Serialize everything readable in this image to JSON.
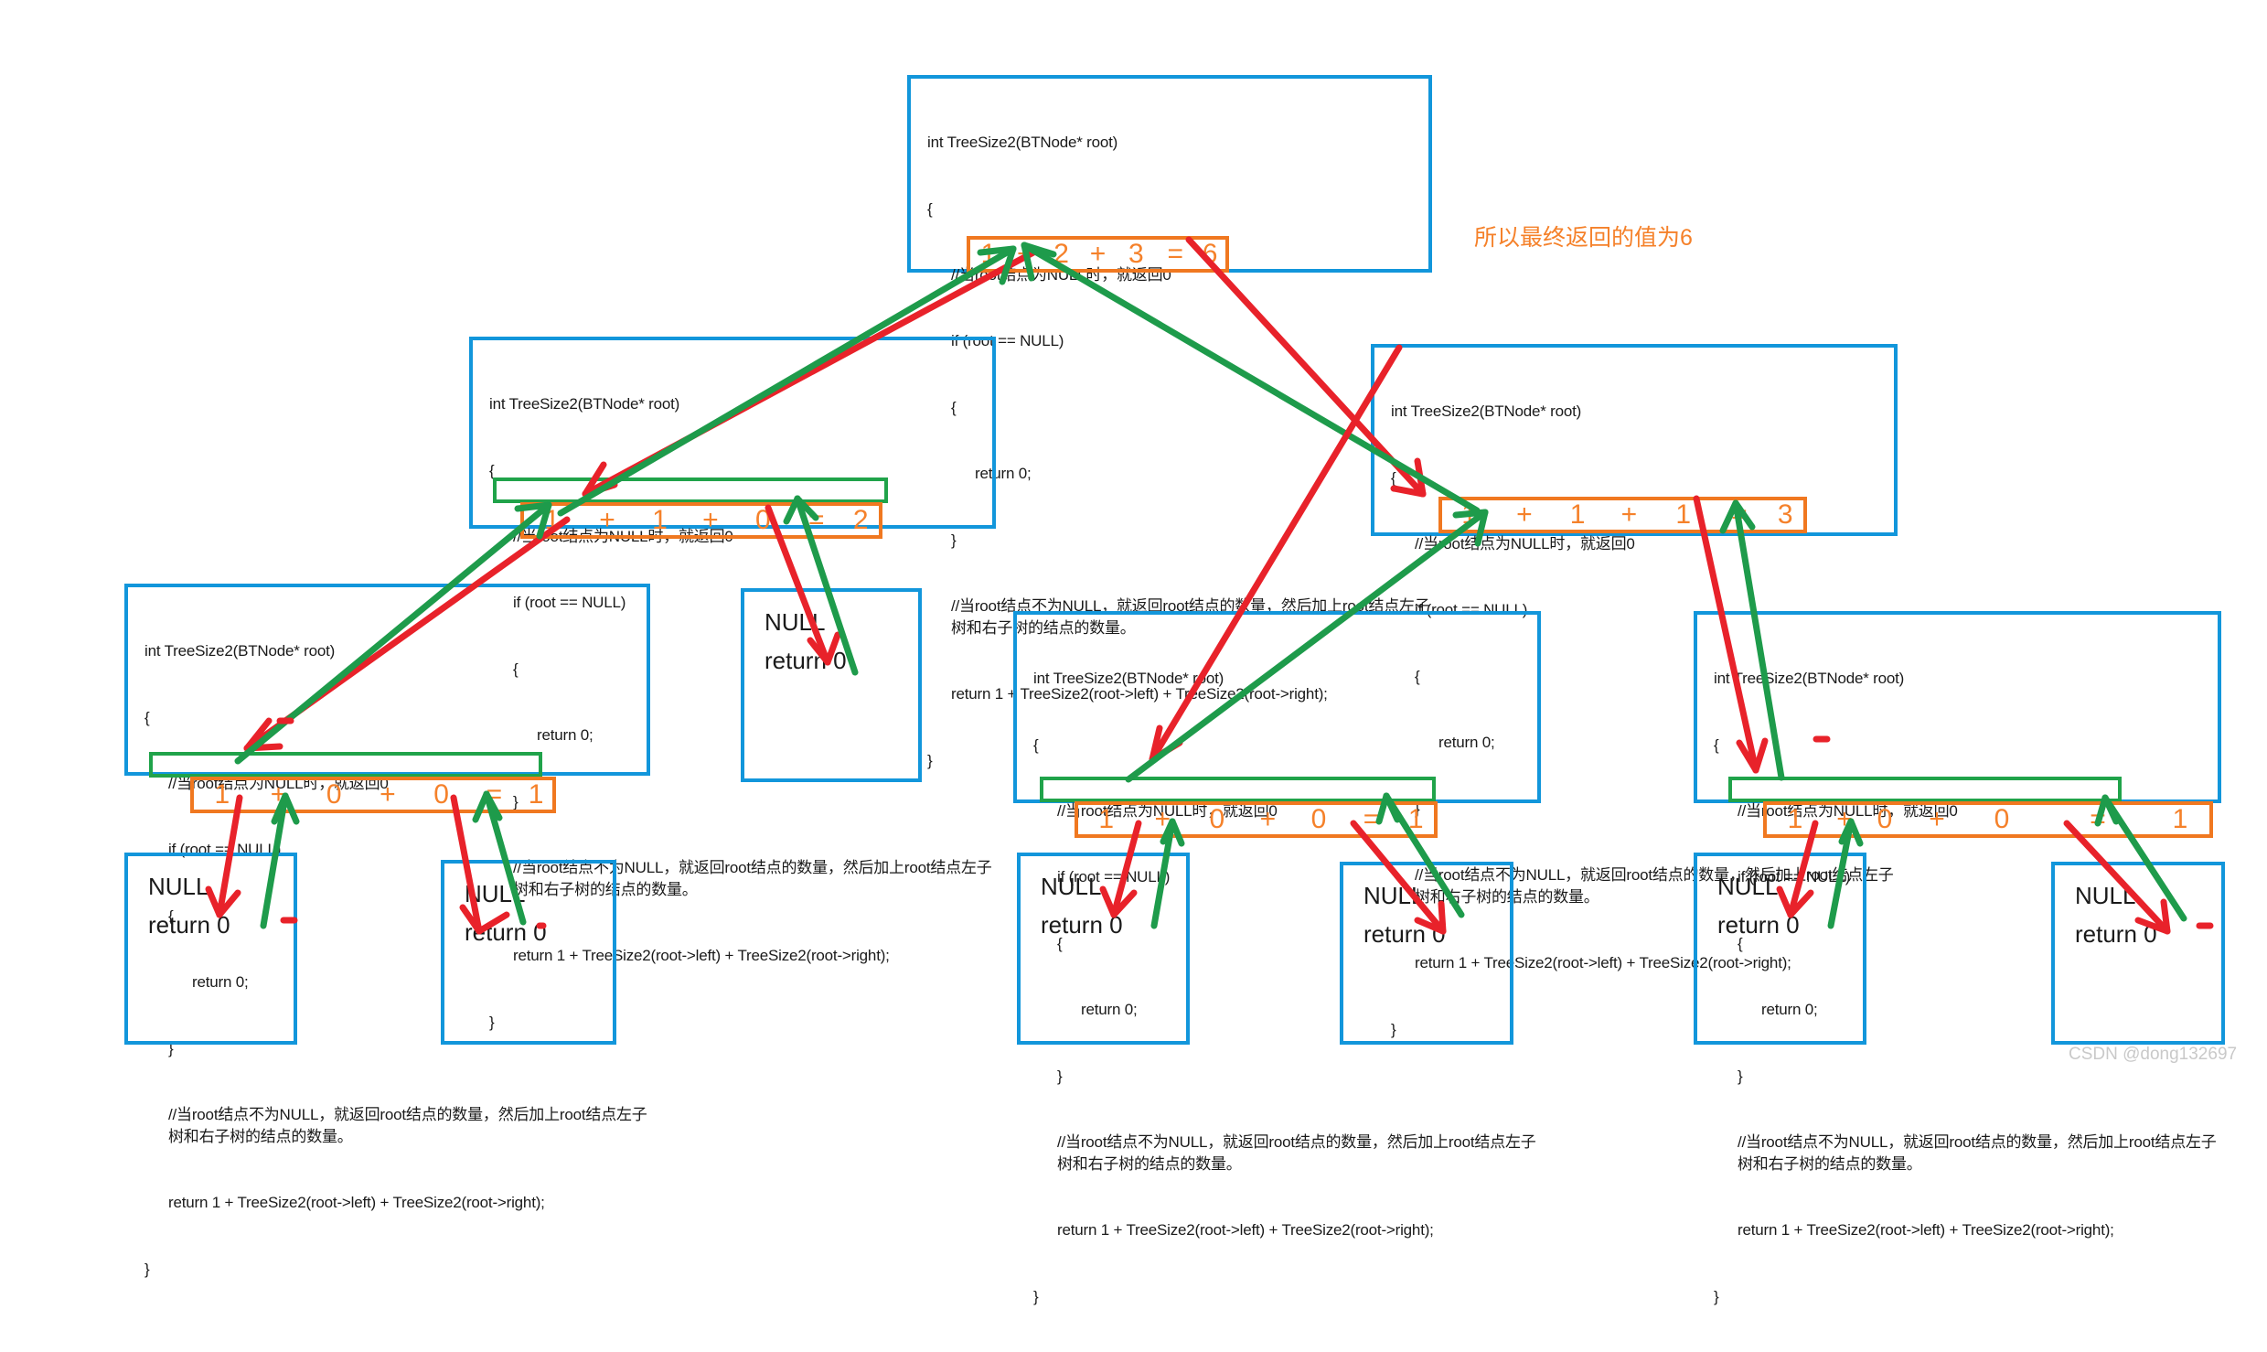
{
  "meta": {
    "watermark": "CSDN @dong132697",
    "colors": {
      "box_border": "#1296db",
      "highlight_green": "#20a34a",
      "result_orange": "#f07820",
      "text": "#1a1a1a",
      "arrow_red": "#e8222a",
      "arrow_green": "#1e9b4b"
    }
  },
  "code": {
    "signature": "int TreeSize2(BTNode* root)",
    "open_brace": "{",
    "comment_null": "//当root结点为NULL时，就返回0",
    "if_line": "if (root == NULL)",
    "inner_open": "{",
    "return_zero": "return 0;",
    "inner_close": "}",
    "comment_recurse": "//当root结点不为NULL，就返回root结点的数量，然后加上root结点左子树和右子树的结点的数量。",
    "return_line": "return 1 + TreeSize2(root->left) + TreeSize2(root->right);",
    "close_brace": "}"
  },
  "annotation": {
    "final_note": "所以最终返回的值为6"
  },
  "nodes": [
    {
      "id": "root-frame",
      "level": 0,
      "kind": "call-frame",
      "result": {
        "a": "1",
        "plus1": "+",
        "b": "2",
        "plus2": "+",
        "c": "3",
        "eq": "=",
        "total": "6"
      },
      "return_highlighted": false
    },
    {
      "id": "level2-left-frame",
      "level": 1,
      "kind": "call-frame",
      "result": {
        "a": "1",
        "plus1": "+",
        "b": "1",
        "plus2": "+",
        "c": "0",
        "eq": "=",
        "total": "2"
      },
      "return_highlighted": true
    },
    {
      "id": "level2-right-frame",
      "level": 1,
      "kind": "call-frame",
      "result": {
        "a": "1",
        "plus1": "+",
        "b": "1",
        "plus2": "+",
        "c": "1",
        "eq": "=",
        "total": "3"
      },
      "return_highlighted": false
    },
    {
      "id": "level3-frame-1",
      "level": 2,
      "kind": "call-frame",
      "result": {
        "a": "1",
        "plus1": "+",
        "b": "0",
        "plus2": "+",
        "c": "0",
        "eq": "=",
        "total": "1"
      },
      "return_highlighted": true
    },
    {
      "id": "level3-null-1",
      "level": 2,
      "kind": "null-leaf",
      "null_label": "NULL",
      "return_label": "return 0"
    },
    {
      "id": "level3-frame-2",
      "level": 2,
      "kind": "call-frame",
      "result": {
        "a": "1",
        "plus1": "+",
        "b": "0",
        "plus2": "+",
        "c": "0",
        "eq": "=",
        "total": "1"
      },
      "return_highlighted": true
    },
    {
      "id": "level3-frame-3",
      "level": 2,
      "kind": "call-frame",
      "result": {
        "a": "1",
        "plus1": "+",
        "b": "0",
        "plus2": "+",
        "c": "0",
        "eq": "=",
        "total": "1"
      },
      "return_highlighted": true
    },
    {
      "id": "leaf-null-1",
      "level": 3,
      "kind": "null-leaf",
      "null_label": "NULL",
      "return_label": "return 0"
    },
    {
      "id": "leaf-null-2",
      "level": 3,
      "kind": "null-leaf",
      "null_label": "NULL",
      "return_label": "return 0"
    },
    {
      "id": "leaf-null-3",
      "level": 3,
      "kind": "null-leaf",
      "null_label": "NULL",
      "return_label": "return 0"
    },
    {
      "id": "leaf-null-4",
      "level": 3,
      "kind": "null-leaf",
      "null_label": "NULL",
      "return_label": "return 0"
    },
    {
      "id": "leaf-null-5",
      "level": 3,
      "kind": "null-leaf",
      "null_label": "NULL",
      "return_label": "return 0"
    },
    {
      "id": "leaf-null-6",
      "level": 3,
      "kind": "null-leaf",
      "null_label": "NULL",
      "return_label": "return 0"
    }
  ]
}
